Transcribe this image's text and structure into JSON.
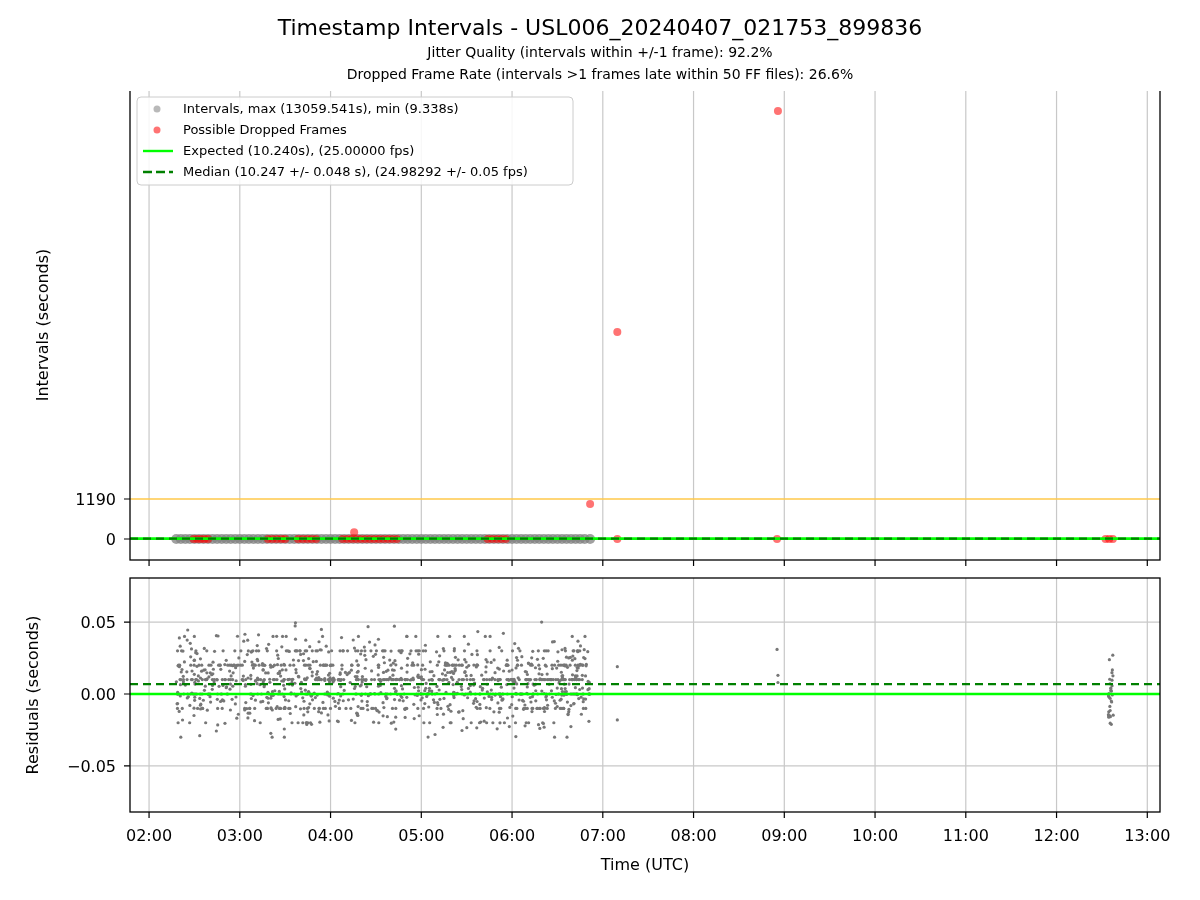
{
  "figure": {
    "title": "Timestamp Intervals - USL006_20240407_021753_899836",
    "subtitles": [
      "Jitter Quality (intervals within +/-1 frame): 92.2%",
      "Dropped Frame Rate (intervals >1 frames late within 50 FF files): 26.6%"
    ]
  },
  "intervals_plot": {
    "chart_data": {
      "type": "scatter",
      "ylabel": "Intervals (seconds)",
      "xlim": [
        1.79,
        13.14
      ],
      "ylim": [
        -625,
        13358
      ],
      "yticks": [
        {
          "value": 0,
          "label": "0"
        },
        {
          "value": 1190,
          "label": "1190"
        }
      ],
      "series": [
        {
          "name": "Intervals, max (13059.541s), min (9.338s)",
          "color": "#808080",
          "x": [
            2.3,
            2.35,
            2.4,
            2.45,
            2.5,
            2.55,
            2.6,
            2.65,
            2.7,
            2.75,
            2.8,
            2.85,
            2.9,
            2.95,
            3.0,
            3.05,
            3.1,
            3.15,
            3.2,
            3.25,
            3.3,
            3.35,
            3.4,
            3.45,
            3.5,
            3.55,
            3.6,
            3.65,
            3.7,
            3.75,
            3.8,
            3.85,
            3.9,
            3.95,
            4.0,
            4.05,
            4.1,
            4.15,
            4.2,
            4.25,
            4.3,
            4.35,
            4.4,
            4.45,
            4.5,
            4.55,
            4.6,
            4.65,
            4.7,
            4.75,
            4.8,
            4.85,
            4.9,
            4.95,
            5.0,
            5.05,
            5.1,
            5.15,
            5.2,
            5.25,
            5.3,
            5.35,
            5.4,
            5.45,
            5.5,
            5.55,
            5.6,
            5.65,
            5.7,
            5.75,
            5.8,
            5.85,
            5.9,
            5.95,
            6.0,
            6.05,
            6.1,
            6.15,
            6.2,
            6.25,
            6.3,
            6.35,
            6.4,
            6.45,
            6.5,
            6.55,
            6.6,
            6.65,
            6.7,
            6.75,
            6.8,
            6.86
          ],
          "values": [
            0,
            0,
            0,
            0,
            0,
            0,
            0,
            0,
            0,
            0,
            0,
            0,
            0,
            0,
            0,
            0,
            0,
            0,
            0,
            0,
            0,
            0,
            0,
            0,
            0,
            0,
            0,
            0,
            0,
            0,
            0,
            0,
            0,
            0,
            0,
            0,
            0,
            0,
            0,
            0,
            0,
            0,
            0,
            0,
            0,
            0,
            0,
            0,
            0,
            0,
            0,
            0,
            0,
            0,
            0,
            0,
            0,
            0,
            0,
            0,
            0,
            0,
            0,
            0,
            0,
            0,
            0,
            0,
            0,
            0,
            0,
            0,
            0,
            0,
            0,
            0,
            0,
            0,
            0,
            0,
            0,
            0,
            0,
            0,
            0,
            0,
            0,
            0,
            0,
            0,
            0,
            0
          ]
        },
        {
          "name": "Possible Dropped Frames",
          "color": "#ff0000",
          "x": [
            2.49,
            2.53,
            2.57,
            2.61,
            2.65,
            3.31,
            3.36,
            3.41,
            3.46,
            3.5,
            3.64,
            3.69,
            3.74,
            3.79,
            3.84,
            4.13,
            4.18,
            4.23,
            4.28,
            4.33,
            4.38,
            4.43,
            4.48,
            4.53,
            4.58,
            4.63,
            4.68,
            4.73,
            5.73,
            5.78,
            5.83,
            5.88,
            5.93,
            4.26,
            6.86,
            7.16,
            7.16,
            8.92,
            8.93,
            12.54,
            12.58,
            12.62
          ],
          "values": [
            0,
            0,
            0,
            0,
            0,
            0,
            0,
            0,
            0,
            0,
            0,
            0,
            0,
            0,
            0,
            0,
            0,
            0,
            0,
            0,
            0,
            0,
            0,
            0,
            0,
            0,
            0,
            0,
            0,
            0,
            0,
            0,
            0,
            200,
            1040,
            6160,
            0,
            0,
            12730,
            0,
            0,
            0
          ]
        }
      ],
      "ref_lines": [
        {
          "axis": "y",
          "value": 1190,
          "color": "#ffc94a"
        },
        {
          "axis": "y",
          "value": 10.24,
          "label": "Expected (10.240s), (25.00000 fps)",
          "color": "#00ff00"
        },
        {
          "axis": "y",
          "value": 10.247,
          "label": "Median (10.247 +/- 0.048 s), (24.98292 +/- 0.05 fps)",
          "color": "#008000"
        }
      ],
      "grid": "x",
      "legend": true
    }
  },
  "residuals_plot": {
    "chart_data": {
      "type": "scatter",
      "xlabel": "Time (UTC)",
      "ylabel": "Residuals (seconds)",
      "xlim": [
        1.79,
        13.14
      ],
      "ylim": [
        -0.082,
        0.0806
      ],
      "xticks": [
        {
          "value": 2,
          "label": "02:00"
        },
        {
          "value": 3,
          "label": "03:00"
        },
        {
          "value": 4,
          "label": "04:00"
        },
        {
          "value": 5,
          "label": "05:00"
        },
        {
          "value": 6,
          "label": "06:00"
        },
        {
          "value": 7,
          "label": "07:00"
        },
        {
          "value": 8,
          "label": "08:00"
        },
        {
          "value": 9,
          "label": "09:00"
        },
        {
          "value": 10,
          "label": "10:00"
        },
        {
          "value": 11,
          "label": "11:00"
        },
        {
          "value": 12,
          "label": "12:00"
        },
        {
          "value": 13,
          "label": "13:00"
        }
      ],
      "yticks": [
        {
          "value": -0.05,
          "label": "−0.05"
        },
        {
          "value": 0,
          "label": "0.00"
        },
        {
          "value": 0.05,
          "label": "0.05"
        }
      ],
      "ref_lines": [
        {
          "axis": "y",
          "value": 0,
          "color": "#00ff00"
        },
        {
          "axis": "y",
          "value": 0.0069,
          "color": "#008000"
        }
      ],
      "grid": "both"
    }
  }
}
